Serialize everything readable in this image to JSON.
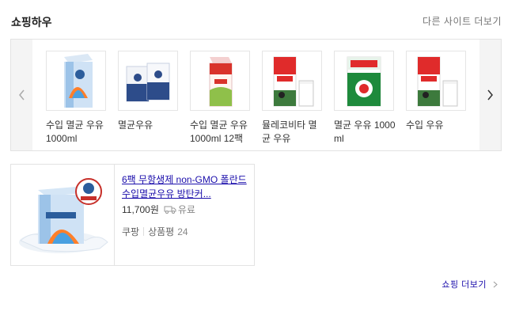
{
  "header": {
    "title": "쇼핑하우",
    "more_sites": "다른 사이트 더보기"
  },
  "carousel": {
    "items": [
      {
        "name": "수입 멸균 우유 1000ml",
        "icon": "milk-carton-blue"
      },
      {
        "name": "멸균우유",
        "icon": "milk-carton-pair"
      },
      {
        "name": "수입 멸균 우유 1000ml 12팩",
        "icon": "milk-carton-red"
      },
      {
        "name": "뮬레코비타 멸균 우유",
        "icon": "milk-carton-cow-glass"
      },
      {
        "name": "멸균 우유 1000ml",
        "icon": "milk-carton-seoul"
      },
      {
        "name": "수입 우유",
        "icon": "milk-carton-cow-glass"
      }
    ]
  },
  "ad": {
    "title": "6팩 무항생제 non-GMO 폴란드 수입멸균우유 방탄커...",
    "price": "11,700원",
    "shipping": "유료",
    "seller": "쿠팡",
    "review_label": "상품평",
    "review_count": "24"
  },
  "footer": {
    "shop_more": "쇼핑 더보기"
  },
  "colors": {
    "link": "#1a0dab",
    "border": "#e3e3e3",
    "nav_bg": "#f4f4f4"
  }
}
